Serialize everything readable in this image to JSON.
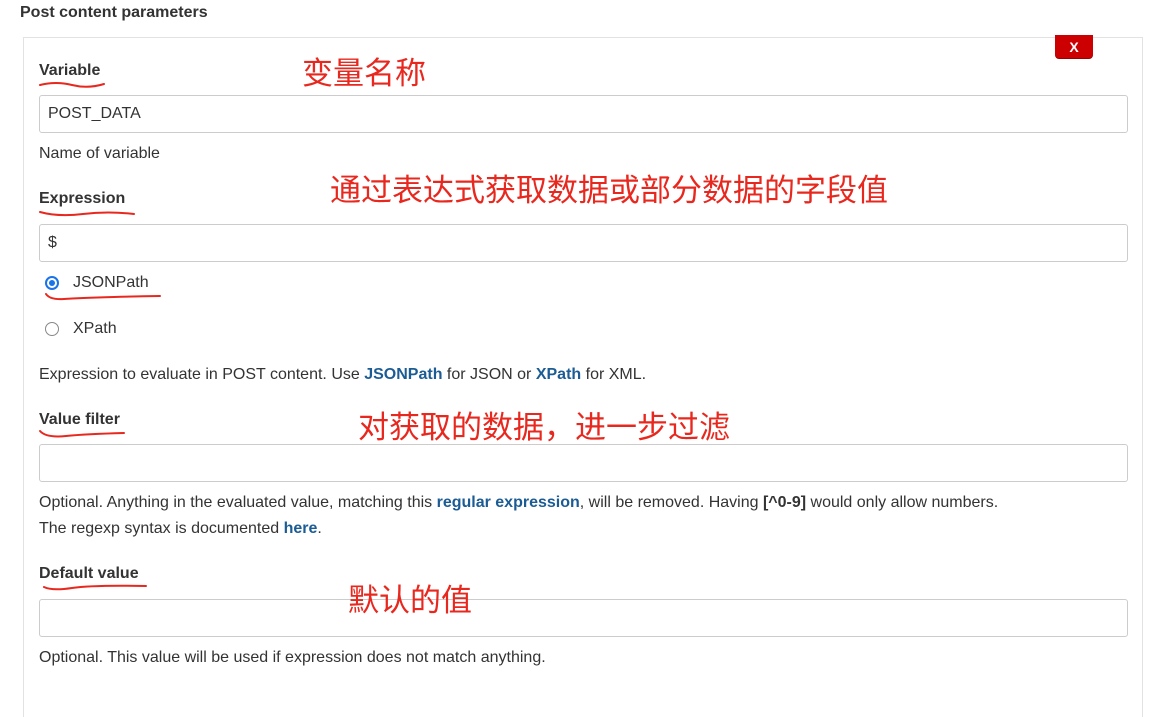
{
  "section_title": "Post content parameters",
  "delete_button": "X",
  "variable": {
    "label": "Variable",
    "value": "POST_DATA",
    "help": "Name of variable"
  },
  "expression": {
    "label": "Expression",
    "value": "$",
    "options": [
      {
        "label": "JSONPath",
        "selected": true
      },
      {
        "label": "XPath",
        "selected": false
      }
    ],
    "help": {
      "before": "Expression to evaluate in POST content. Use ",
      "link1": "JSONPath",
      "middle": " for JSON or ",
      "link2": "XPath",
      "after": " for XML."
    }
  },
  "value_filter": {
    "label": "Value filter",
    "value": "",
    "help": {
      "part1": "Optional. Anything in the evaluated value, matching this ",
      "link": "regular expression",
      "part2": ", will be removed. Having ",
      "code": "[^0-9]",
      "part3": " would only allow numbers.",
      "line2_before": "The regexp syntax is documented ",
      "line2_link": "here",
      "line2_after": "."
    }
  },
  "default_value": {
    "label": "Default value",
    "value": "",
    "help": "Optional. This value will be used if expression does not match anything."
  },
  "annotations": {
    "variable": "变量名称",
    "expression": "通过表达式获取数据或部分数据的字段值",
    "value_filter": "对获取的数据，进一步过滤",
    "default_value": "默认的值"
  },
  "colors": {
    "annotation": "#e8281e",
    "link": "#1c5c94",
    "delete_button": "#cc0000",
    "radio_selected": "#1a73e8"
  }
}
